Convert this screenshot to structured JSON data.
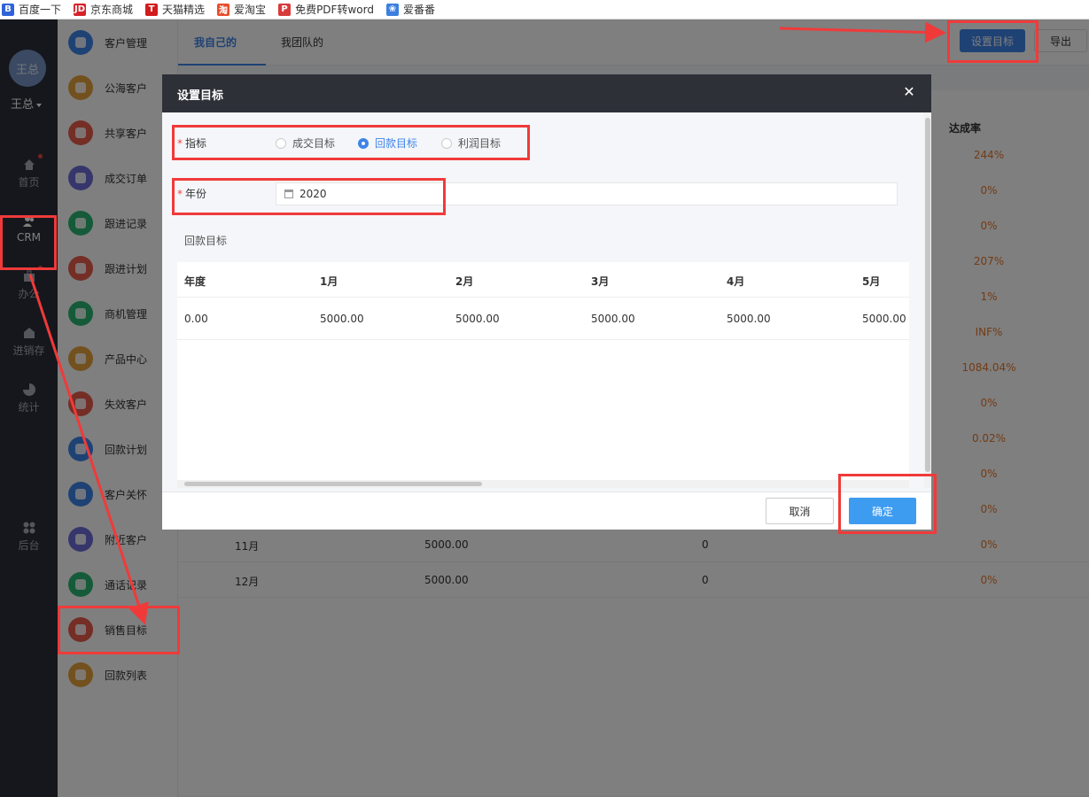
{
  "bookmarks": [
    {
      "label": "百度一下",
      "color": "#2f63d8",
      "icon": "baidu-icon",
      "glyph": "B"
    },
    {
      "label": "京东商城",
      "color": "#d6222a",
      "icon": "jd-icon",
      "glyph": "JD"
    },
    {
      "label": "天猫精选",
      "color": "#d21b1b",
      "icon": "tmall-icon",
      "glyph": "T"
    },
    {
      "label": "爱淘宝",
      "color": "#e84d2a",
      "icon": "taobao-icon",
      "glyph": "淘"
    },
    {
      "label": "免费PDF转word",
      "color": "#d83b3b",
      "icon": "pdf-icon",
      "glyph": "P"
    },
    {
      "label": "爱番番",
      "color": "#3b7fe0",
      "icon": "paw-icon",
      "glyph": "❀"
    }
  ],
  "user": {
    "avatar_text": "王总",
    "name": "王总"
  },
  "nav": [
    {
      "label": "首页",
      "icon": "home-icon",
      "badge": true
    },
    {
      "label": "CRM",
      "icon": "crm-icon",
      "badge": false,
      "active": true
    },
    {
      "label": "办公",
      "icon": "briefcase-icon",
      "badge": true
    },
    {
      "label": "进销存",
      "icon": "warehouse-icon",
      "badge": false
    },
    {
      "label": "统计",
      "icon": "pie-chart-icon",
      "badge": false
    },
    {
      "label": "后台",
      "icon": "grid-icon",
      "badge": false
    }
  ],
  "menu": [
    {
      "label": "客户管理",
      "color": "#3e84e9"
    },
    {
      "label": "公海客户",
      "color": "#e6a23c"
    },
    {
      "label": "共享客户",
      "color": "#e85c4a"
    },
    {
      "label": "成交订单",
      "color": "#6c6cd8"
    },
    {
      "label": "跟进记录",
      "color": "#2bb673"
    },
    {
      "label": "跟进计划",
      "color": "#e85c4a"
    },
    {
      "label": "商机管理",
      "color": "#2bb673"
    },
    {
      "label": "产品中心",
      "color": "#e6a23c"
    },
    {
      "label": "失效客户",
      "color": "#e85c4a"
    },
    {
      "label": "回款计划",
      "color": "#3e84e9"
    },
    {
      "label": "客户关怀",
      "color": "#3e84e9"
    },
    {
      "label": "附近客户",
      "color": "#6c6cd8"
    },
    {
      "label": "通话记录",
      "color": "#2bb673"
    },
    {
      "label": "销售目标",
      "color": "#e85c4a"
    },
    {
      "label": "回款列表",
      "color": "#e6a23c"
    }
  ],
  "main": {
    "tabs": [
      "我自己的",
      "我团队的"
    ],
    "set_goal_button": "设置目标",
    "export_button": "导出",
    "rate_header": "达成率",
    "rates": [
      "244%",
      "0%",
      "0%",
      "207%",
      "1%",
      "INF%",
      "1084.04%",
      "0%",
      "0.02%",
      "0%",
      "0%"
    ],
    "rows": [
      {
        "month": "11月",
        "target": "5000.00",
        "done": "0",
        "rate": "0%"
      },
      {
        "month": "12月",
        "target": "5000.00",
        "done": "0",
        "rate": "0%"
      }
    ]
  },
  "dialog": {
    "title": "设置目标",
    "indicator_label": "指标",
    "radios": [
      {
        "label": "成交目标",
        "checked": false
      },
      {
        "label": "回款目标",
        "checked": true
      },
      {
        "label": "利润目标",
        "checked": false
      }
    ],
    "year_label": "年份",
    "year_value": "2020",
    "section_title": "回款目标",
    "table_headers": [
      "年度",
      "1月",
      "2月",
      "3月",
      "4月",
      "5月"
    ],
    "table_values": [
      "0.00",
      "5000.00",
      "5000.00",
      "5000.00",
      "5000.00",
      "5000.00"
    ],
    "cancel_button": "取消",
    "confirm_button": "确定"
  },
  "colors": {
    "primary": "#3e84e9",
    "annotation": "#f03a3a",
    "rate": "#e6772b"
  }
}
